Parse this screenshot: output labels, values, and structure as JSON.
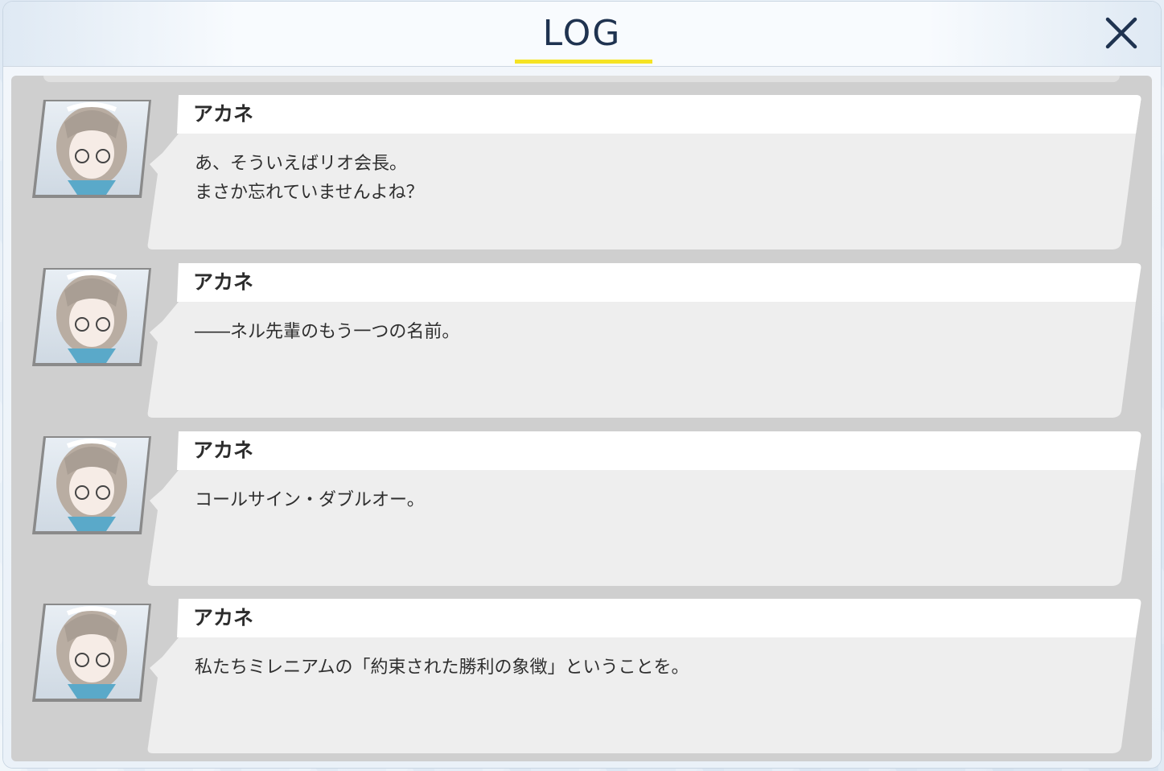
{
  "header": {
    "title": "LOG",
    "accent_color": "#f5e324",
    "close_icon": "close-icon"
  },
  "log": {
    "entries": [
      {
        "speaker": "アカネ",
        "avatar_icon": "character-portrait-icon",
        "text": "あ、そういえばリオ会長。\nまさか忘れていませんよね？"
      },
      {
        "speaker": "アカネ",
        "avatar_icon": "character-portrait-icon",
        "text": "――ネル先輩のもう一つの名前。"
      },
      {
        "speaker": "アカネ",
        "avatar_icon": "character-portrait-icon",
        "text": "コールサイン・ダブルオー。"
      },
      {
        "speaker": "アカネ",
        "avatar_icon": "character-portrait-icon",
        "text": "私たちミレニアムの「約束された勝利の象徴」ということを。"
      }
    ]
  }
}
